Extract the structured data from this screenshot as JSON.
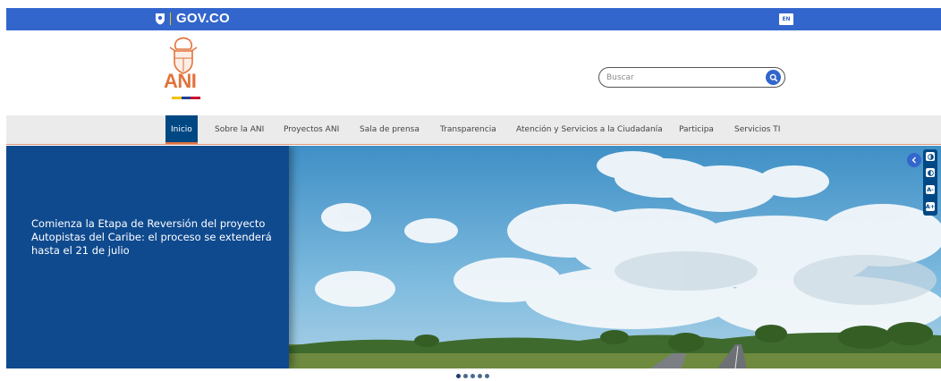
{
  "gov_bar": {
    "logo_text": "GOV.CO",
    "lang_label": "EN"
  },
  "brand": {
    "acronym": "ANI",
    "flag_colors": [
      "#f3c300",
      "#1f3f94",
      "#c8102e"
    ]
  },
  "search": {
    "placeholder": "Buscar"
  },
  "nav": {
    "items": [
      {
        "label": "Inicio",
        "active": true
      },
      {
        "label": "Sobre la ANI"
      },
      {
        "label": "Proyectos ANI"
      },
      {
        "label": "Sala de prensa"
      },
      {
        "label": "Transparencia"
      },
      {
        "label": "Atención y Servicios a la Ciudadanía"
      },
      {
        "label": "Participa"
      },
      {
        "label": "Servicios TI"
      }
    ]
  },
  "hero": {
    "caption": "Comienza la Etapa de Reversión del proyecto Autopistas del Caribe: el proceso se extenderá hasta el 21 de julio"
  },
  "accessibility": {
    "buttons": [
      {
        "icon": "contrast-icon"
      },
      {
        "icon": "contrast-invert-icon"
      },
      {
        "label": "A-",
        "icon": "font-decrease-icon"
      },
      {
        "label": "A+",
        "icon": "font-increase-icon"
      }
    ]
  },
  "carousel": {
    "slide_count": 5,
    "active_index": 1
  },
  "colors": {
    "gov_blue": "#3366cc",
    "navy": "#004884",
    "accent": "#e2733c"
  }
}
